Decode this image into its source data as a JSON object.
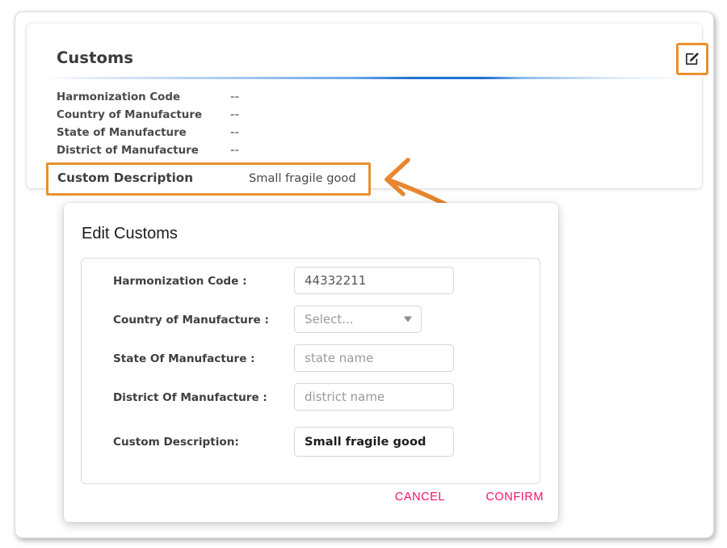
{
  "card": {
    "title": "Customs",
    "edit_icon": "edit-pencil-square-icon",
    "rows": [
      {
        "label": "Harmonization Code",
        "value": "--"
      },
      {
        "label": "Country of Manufacture",
        "value": "--"
      },
      {
        "label": "State of Manufacture",
        "value": "--"
      },
      {
        "label": "District of Manufacture",
        "value": "--"
      }
    ],
    "highlighted_row": {
      "label": "Custom Description",
      "value": "Small fragile good"
    }
  },
  "modal": {
    "title": "Edit Customs",
    "fields": [
      {
        "label": "Harmonization Code :",
        "value": "44332211",
        "placeholder": "",
        "type": "text"
      },
      {
        "label": "Country of Manufacture :",
        "value": "",
        "placeholder": "Select...",
        "type": "select",
        "caret_icon": "chevron-down-icon"
      },
      {
        "label": "State Of Manufacture :",
        "value": "",
        "placeholder": "state name",
        "type": "text"
      },
      {
        "label": "District Of Manufacture :",
        "value": "",
        "placeholder": "district name",
        "type": "text"
      },
      {
        "label": "Custom Description:",
        "value": "Small fragile good",
        "placeholder": "",
        "type": "text"
      }
    ],
    "cancel_label": "CANCEL",
    "confirm_label": "CONFIRM"
  },
  "annotation": {
    "arrow_icon": "curved-arrow-left-icon",
    "color": "#e8862d"
  },
  "colors": {
    "highlight_orange": "#e8912d",
    "action_pink": "#f5116b",
    "divider_blue": "#1f6fd0"
  }
}
